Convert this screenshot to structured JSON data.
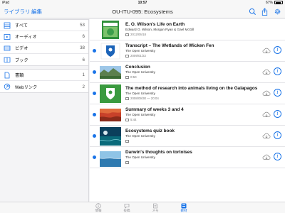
{
  "statusbar": {
    "device": "iPad",
    "wifi_icon": "wifi-icon",
    "time": "10:57",
    "battery_percent": "67%"
  },
  "navbar": {
    "library_label": "ライブラリ",
    "edit_label": "編集",
    "title": "OU-ITU-095: Ecosystems",
    "icons": [
      "search-icon",
      "share-icon",
      "gear-icon"
    ],
    "accent": "#1a74e8"
  },
  "sidebar": {
    "items": [
      {
        "label": "すべて",
        "count": "53",
        "icon": "all-items-icon"
      },
      {
        "label": "オーディオ",
        "count": "6",
        "icon": "audio-icon"
      },
      {
        "label": "ビデオ",
        "count": "38",
        "icon": "video-icon"
      },
      {
        "label": "ブック",
        "count": "6",
        "icon": "book-icon"
      },
      {
        "label": "書類",
        "count": "1",
        "icon": "document-icon"
      },
      {
        "label": "Webリンク",
        "count": "2",
        "icon": "web-link-icon"
      }
    ]
  },
  "items": [
    {
      "title": "E. O. Wilson's Life on Earth",
      "subtitle": "Edward O. Wilson, Morgan Ryan & Gael McGill",
      "meta": "2012/06/18",
      "meta_icon": "book-icon",
      "unread": false,
      "thumb": "book-cover"
    },
    {
      "title": "Transcript – The Wetlands of Wicken Fen",
      "subtitle": "The Open University",
      "meta": "2009/01/22",
      "meta_icon": "document-icon",
      "unread": true,
      "thumb": "ou-logo"
    },
    {
      "title": "Conclusion",
      "subtitle": "The Open University",
      "meta": "0:50",
      "meta_icon": "video-icon",
      "unread": true,
      "thumb": "landscape"
    },
    {
      "title": "The method of research into animals living on the Galapagos",
      "subtitle": "The Open University",
      "meta": "2008/09/30 — 20:04",
      "meta_icon": "audio-icon",
      "unread": true,
      "thumb": "ou-logo-green"
    },
    {
      "title": "Summary of weeks 3 and 4",
      "subtitle": "The Open University",
      "meta": "5:44",
      "meta_icon": "video-icon",
      "unread": true,
      "thumb": "red-rock"
    },
    {
      "title": "Ecosystems quiz book",
      "subtitle": "The Open University",
      "meta": "",
      "meta_icon": "book-icon",
      "unread": true,
      "thumb": "ocean"
    },
    {
      "title": "Darwin's thoughts on tortoises",
      "subtitle": "The Open University",
      "meta": "",
      "meta_icon": "video-icon",
      "unread": true,
      "thumb": "sea"
    }
  ],
  "tabbar": {
    "tabs": [
      {
        "label": "情報",
        "icon": "info-icon",
        "active": false
      },
      {
        "label": "投稿",
        "icon": "post-icon",
        "active": false
      },
      {
        "label": "メモ",
        "icon": "note-icon",
        "active": false
      },
      {
        "label": "教材",
        "icon": "materials-icon",
        "active": true
      }
    ]
  }
}
